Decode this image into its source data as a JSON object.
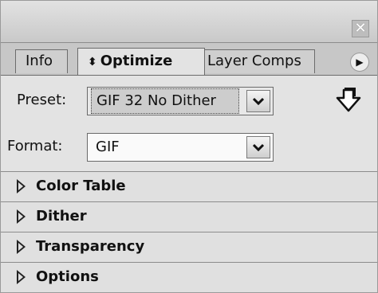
{
  "window": {
    "close_symbol": "✕"
  },
  "tabs": [
    {
      "label": "Info",
      "active": false
    },
    {
      "label": "Optimize",
      "active": true,
      "icon": "up-down-arrows-icon"
    },
    {
      "label": "Layer Comps",
      "active": false
    }
  ],
  "tab_optimize_arrows": "⬍",
  "flyout_symbol": "▶",
  "preset": {
    "label": "Preset:",
    "value": "GIF 32 No Dither"
  },
  "format": {
    "label": "Format:",
    "value": "GIF"
  },
  "dropdown_symbol": "✔",
  "sections": [
    {
      "label": "Color Table"
    },
    {
      "label": "Dither"
    },
    {
      "label": "Transparency"
    },
    {
      "label": "Options"
    }
  ],
  "colors": {
    "panel_bg": "#e3e3e3",
    "tabstrip_bg": "#c7c7c7",
    "titlebar_bg": "#d6d6d6"
  }
}
